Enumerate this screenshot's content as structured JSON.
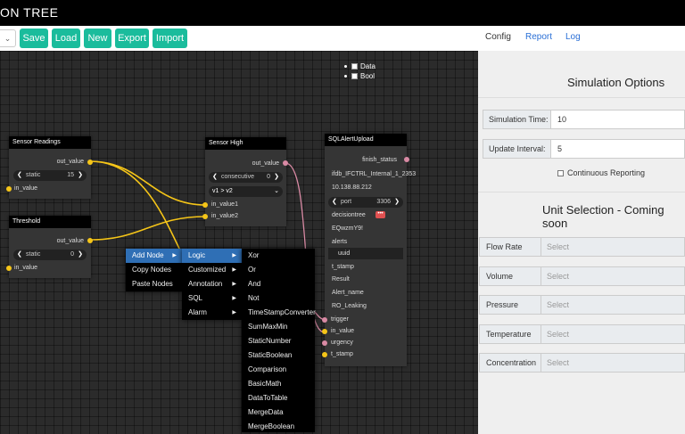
{
  "app": {
    "title": "ON TREE"
  },
  "toolbar": {
    "dropdown_caret": "⌄",
    "buttons": [
      "Save",
      "Load",
      "New",
      "Export",
      "Import"
    ]
  },
  "legend": {
    "items": [
      "Data",
      "Bool"
    ]
  },
  "nodes": {
    "sensor_readings": {
      "title": "Sensor Readings",
      "output": "out_value",
      "widget_label": "static",
      "widget_value": "15",
      "input": "in_value"
    },
    "threshold": {
      "title": "Threshold",
      "output": "out_value",
      "widget_label": "static",
      "widget_value": "0",
      "input": "in_value"
    },
    "sensor_high": {
      "title": "Sensor High",
      "output": "out_value",
      "widget_label": "consecutive",
      "widget_value": "0",
      "combo_value": "v1 > v2",
      "inputs": [
        "in_value1",
        "in_value2"
      ]
    },
    "sql_alert": {
      "title": "SQLAlertUpload",
      "output": "finish_status",
      "db_path": "ifdb_IFCTRL_Internal_1_2353",
      "ip": "10.138.88.212",
      "port_label": "port",
      "port_value": "3306",
      "fields": [
        "decisiontree",
        "EQwzmY9!",
        "alerts",
        "uuid",
        "t_stamp",
        "Result",
        "Alert_name",
        "RO_Leaking"
      ],
      "inputs": [
        "trigger",
        "in_value",
        "urgency",
        "t_stamp"
      ]
    }
  },
  "context_menu": {
    "main": [
      "Add Node",
      "Copy Nodes",
      "Paste Nodes"
    ],
    "categories": [
      "Logic",
      "Customized",
      "Annotation",
      "SQL",
      "Alarm"
    ],
    "logic_items": [
      "Xor",
      "Or",
      "And",
      "Not",
      "TimeStampConverter",
      "SumMaxMin",
      "StaticNumber",
      "StaticBoolean",
      "Comparison",
      "BasicMath",
      "DataToTable",
      "MergeData",
      "MergeBoolean"
    ]
  },
  "right_panel": {
    "tabs": [
      "Config",
      "Report",
      "Log"
    ],
    "simulation": {
      "title": "Simulation Options",
      "time_label": "Simulation Time:",
      "time_value": "10",
      "interval_label": "Update Interval:",
      "interval_value": "5",
      "continuous_label": "Continuous Reporting"
    },
    "units": {
      "title": "Unit Selection - Coming soon",
      "placeholder": "Select",
      "rows": [
        "Flow Rate",
        "Volume",
        "Pressure",
        "Temperature",
        "Concentration"
      ]
    }
  },
  "colors": {
    "accent": "#1abc9c",
    "link": "#2a6fd6",
    "menu_highlight": "#2f6fb5",
    "wire": "#f5c518",
    "bool_pin": "#d98aa4"
  }
}
